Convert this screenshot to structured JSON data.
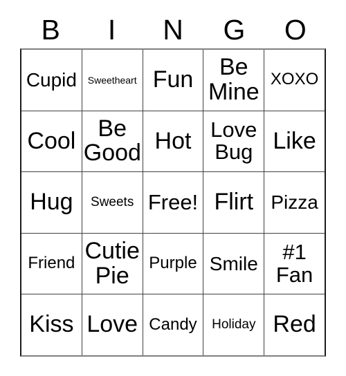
{
  "card": {
    "headers": [
      "B",
      "I",
      "N",
      "G",
      "O"
    ],
    "rows": [
      [
        {
          "text": "Cupid",
          "size": "lg"
        },
        {
          "text": "Sweetheart",
          "size": "xs"
        },
        {
          "text": "Fun",
          "size": "xxl"
        },
        {
          "text": "Be\nMine",
          "size": "xxl"
        },
        {
          "text": "XOXO",
          "size": "md"
        }
      ],
      [
        {
          "text": "Cool",
          "size": "xxl"
        },
        {
          "text": "Be\nGood",
          "size": "xxl"
        },
        {
          "text": "Hot",
          "size": "xxl"
        },
        {
          "text": "Love\nBug",
          "size": "xl"
        },
        {
          "text": "Like",
          "size": "xxl"
        }
      ],
      [
        {
          "text": "Hug",
          "size": "xxl"
        },
        {
          "text": "Sweets",
          "size": "sm"
        },
        {
          "text": "Free!",
          "size": "xl"
        },
        {
          "text": "Flirt",
          "size": "xxl"
        },
        {
          "text": "Pizza",
          "size": "lg"
        }
      ],
      [
        {
          "text": "Friend",
          "size": "md"
        },
        {
          "text": "Cutie\nPie",
          "size": "xxl"
        },
        {
          "text": "Purple",
          "size": "md"
        },
        {
          "text": "Smile",
          "size": "lg"
        },
        {
          "text": "#1\nFan",
          "size": "xl"
        }
      ],
      [
        {
          "text": "Kiss",
          "size": "xxl"
        },
        {
          "text": "Love",
          "size": "xxl"
        },
        {
          "text": "Candy",
          "size": "md"
        },
        {
          "text": "Holiday",
          "size": "sm"
        },
        {
          "text": "Red",
          "size": "xxl"
        }
      ]
    ],
    "free_space_label": "Free!",
    "colors": {
      "background": "#ffffff",
      "text": "#000000",
      "grid_line": "#404040",
      "grid_border": "#1a1a1a"
    }
  }
}
